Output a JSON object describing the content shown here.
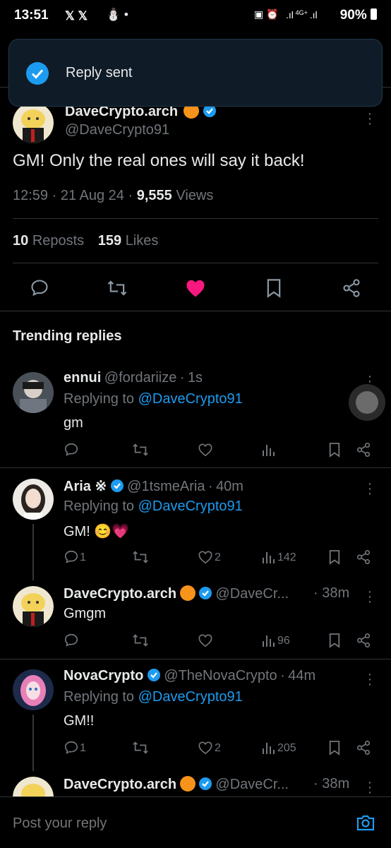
{
  "status_bar": {
    "time": "13:51",
    "battery": "90%",
    "network": "4G+"
  },
  "toast": {
    "text": "Reply sent"
  },
  "tweet": {
    "author_name": "DaveCrypto.arch",
    "handle": "@DaveCrypto91",
    "text": "GM! Only the real ones will say it back!",
    "time": "12:59",
    "date": "21 Aug 24",
    "views_count": "9,555",
    "views_label": "Views",
    "reposts_count": "10",
    "reposts_label": "Reposts",
    "likes_count": "159",
    "likes_label": "Likes",
    "liked": true
  },
  "section_title": "Trending replies",
  "replies": [
    {
      "name": "ennui",
      "handle": "@fordariize",
      "time": "1s",
      "replying_prefix": "Replying to",
      "replying_to": "@DaveCrypto91",
      "text": "gm",
      "replies": "",
      "reposts": "",
      "likes": "",
      "views": ""
    },
    {
      "name": "Aria ※",
      "handle": "@1tsmeAria",
      "time": "40m",
      "replying_prefix": "Replying to",
      "replying_to": "@DaveCrypto91",
      "text": "GM! 😊💗",
      "replies": "1",
      "reposts": "",
      "likes": "2",
      "views": "142"
    },
    {
      "name": "DaveCrypto.arch",
      "handle": "@DaveCr...",
      "time": "38m",
      "text": "Gmgm",
      "replies": "",
      "reposts": "",
      "likes": "",
      "views": "96"
    },
    {
      "name": "NovaCrypto",
      "handle": "@TheNovaCrypto",
      "time": "44m",
      "replying_prefix": "Replying to",
      "replying_to": "@DaveCrypto91",
      "text": "GM!!",
      "replies": "1",
      "reposts": "",
      "likes": "2",
      "views": "205"
    },
    {
      "name": "DaveCrypto.arch",
      "handle": "@DaveCr...",
      "time": "38m"
    }
  ],
  "composer": {
    "placeholder": "Post your reply"
  },
  "colors": {
    "accent": "#1d9bf0",
    "like": "#f91880",
    "background": "#000000",
    "toast": "#0f1b27"
  },
  "icons": [
    "x-logo-icon",
    "alarm-icon",
    "signal-icon",
    "check-icon",
    "verified-icon",
    "orange-badge-icon",
    "more-icon",
    "reply-icon",
    "repost-icon",
    "like-icon",
    "views-icon",
    "bookmark-icon",
    "share-icon",
    "camera-icon"
  ]
}
